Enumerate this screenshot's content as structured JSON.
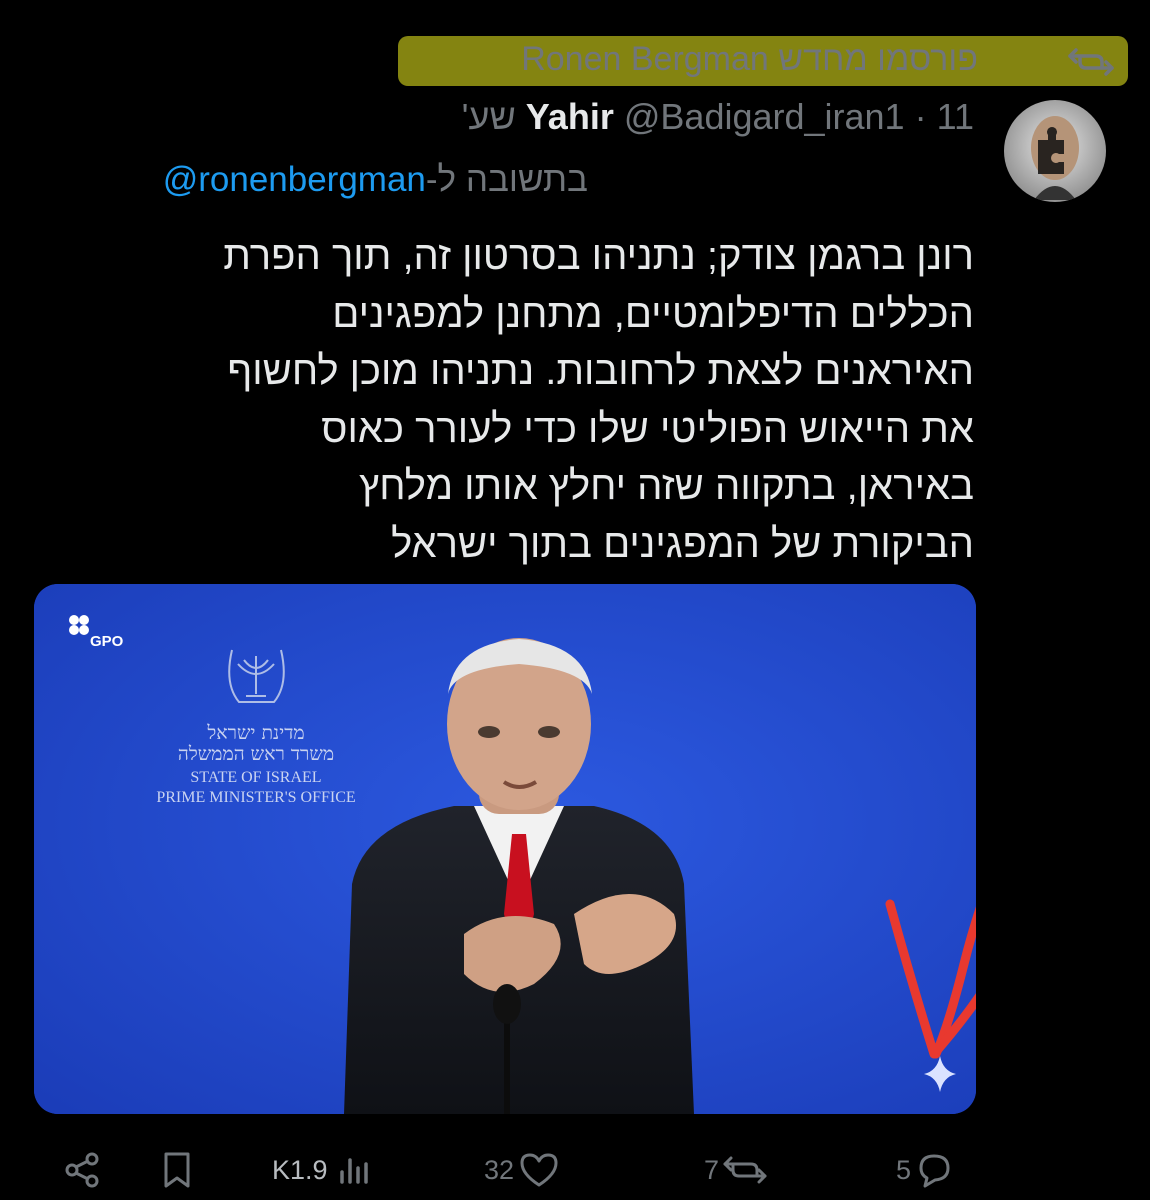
{
  "repost_header": {
    "reposter": "Ronen Bergman",
    "label": "פורסמו מחדש",
    "icon": "repost-icon",
    "highlight_color": "#8f8f12"
  },
  "tweet": {
    "display_name": "Yahir",
    "handle": "@Badigard_iran1",
    "separator": "·",
    "time": "11 שע'",
    "reply_prefix": "בתשובה ל-",
    "reply_handle": "@ronenbergman",
    "text": "רונן ברגמן צודק; נתניהו בסרטון זה, תוך הפרת הכללים הדיפלומטיים, מתחנן למפגינים האיראנים לצאת לרחובות. נתניהו מוכן לחשוף את הייאוש הפוליטי שלו כדי לעורר כאוס באיראן, בתקווה שזה יחלץ אותו מלחץ הביקורת של המפגינים בתוך ישראל"
  },
  "media": {
    "gpo_label": "GPO",
    "seal_hebrew_1": "מדינת ישראל",
    "seal_hebrew_2": "משרד ראש הממשלה",
    "seal_english_1": "STATE OF ISRAEL",
    "seal_english_2": "PRIME MINISTER'S OFFICE",
    "background_color": "#1c3fbf",
    "annotation_arrow_color": "#e8392f",
    "ai_marker_icon": "sparkle-icon"
  },
  "actions": {
    "share_icon": "share-icon",
    "bookmark_icon": "bookmark-icon",
    "views": "K1.9",
    "likes": "32",
    "reposts": "7",
    "replies": "5"
  }
}
